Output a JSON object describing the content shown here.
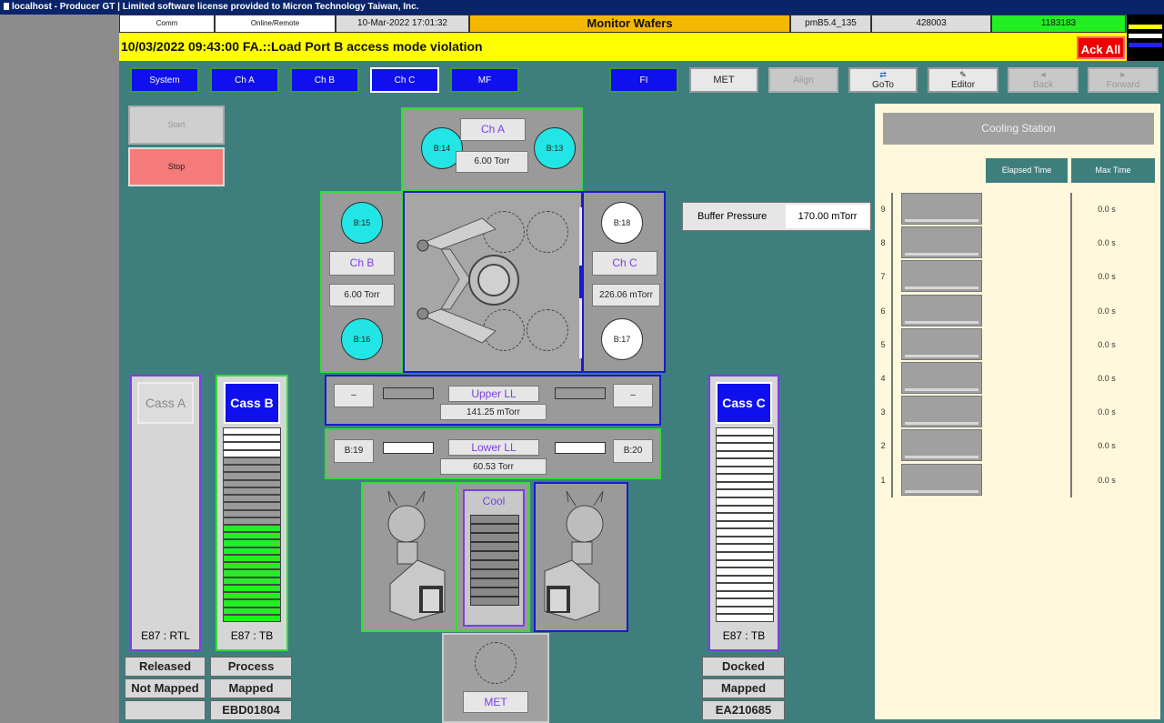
{
  "titlebar": {
    "text": "localhost - Producer GT | Limited software license provided to Micron Technology Taiwan, Inc."
  },
  "header": {
    "comm": "Comm",
    "online": "Online/Remote",
    "datetime": "10-Mar-2022 17:01:32",
    "screen": "Monitor Wafers",
    "version": "pmB5.4_135",
    "id1": "428003",
    "id2": "1183183"
  },
  "alarm": {
    "text": "10/03/2022 09:43:00 FA.::Load Port B access mode violation",
    "ack_label": "Ack All"
  },
  "nav": {
    "system": "System",
    "cha": "Ch A",
    "chb": "Ch B",
    "chc": "Ch C",
    "mf": "MF",
    "fi": "FI",
    "met": "MET",
    "align": "Align",
    "goto": "GoTo",
    "editor": "Editor",
    "back": "Back",
    "forward": "Forward"
  },
  "controls": {
    "start": "Start",
    "stop": "Stop"
  },
  "chamber_a": {
    "label": "Ch A",
    "pressure": "6.00 Torr",
    "slot_left": "B:14",
    "slot_right": "B:13"
  },
  "chamber_b": {
    "label": "Ch B",
    "pressure": "6.00 Torr",
    "slot_top": "B:15",
    "slot_bottom": "B:16"
  },
  "chamber_c": {
    "label": "Ch C",
    "pressure": "226.06 mTorr",
    "slot_top": "B:18",
    "slot_bottom": "B:17"
  },
  "buffer": {
    "label": "Buffer Pressure",
    "value": "170.00 mTorr"
  },
  "upper_ll": {
    "label": "Upper LL",
    "pressure": "141.25 mTorr",
    "left": "–",
    "right": "–"
  },
  "lower_ll": {
    "label": "Lower LL",
    "pressure": "60.53 Torr",
    "left": "B:19",
    "right": "B:20"
  },
  "cool": {
    "label": "Cool"
  },
  "met_station": {
    "label": "MET"
  },
  "cass_a": {
    "label": "Cass A",
    "mode": "E87 : RTL",
    "status1": "Released",
    "status2": "Not Mapped",
    "carrier_id": ""
  },
  "cass_b": {
    "label": "Cass B",
    "mode": "E87 : TB",
    "status1": "Process",
    "status2": "Mapped",
    "carrier_id": "EBD01804"
  },
  "cass_c": {
    "label": "Cass C",
    "mode": "E87 : TB",
    "status1": "Docked",
    "status2": "Mapped",
    "carrier_id": "EA210685"
  },
  "cooling_station": {
    "title": "Cooling Station",
    "col_elapsed": "Elapsed Time",
    "col_max": "Max Time",
    "rows": [
      {
        "slot": "9",
        "max": "0.0 s"
      },
      {
        "slot": "8",
        "max": "0.0 s"
      },
      {
        "slot": "7",
        "max": "0.0 s"
      },
      {
        "slot": "6",
        "max": "0.0 s"
      },
      {
        "slot": "5",
        "max": "0.0 s"
      },
      {
        "slot": "4",
        "max": "0.0 s"
      },
      {
        "slot": "3",
        "max": "0.0 s"
      },
      {
        "slot": "2",
        "max": "0.0 s"
      },
      {
        "slot": "1",
        "max": "0.0 s"
      }
    ]
  },
  "colors": {
    "background": "#3e7f7e",
    "alarm": "#ffff00",
    "ok_green": "#22ee22",
    "chamber_cyan": "#22e6e6",
    "nav_blue": "#1010ee"
  },
  "cass_b_slots": [
    "white",
    "white",
    "white",
    "white",
    "gray",
    "gray",
    "gray",
    "gray",
    "gray",
    "gray",
    "gray",
    "gray",
    "gray",
    "green",
    "green",
    "green",
    "green",
    "green",
    "green",
    "green",
    "green",
    "green",
    "green",
    "green",
    "green",
    "green"
  ]
}
